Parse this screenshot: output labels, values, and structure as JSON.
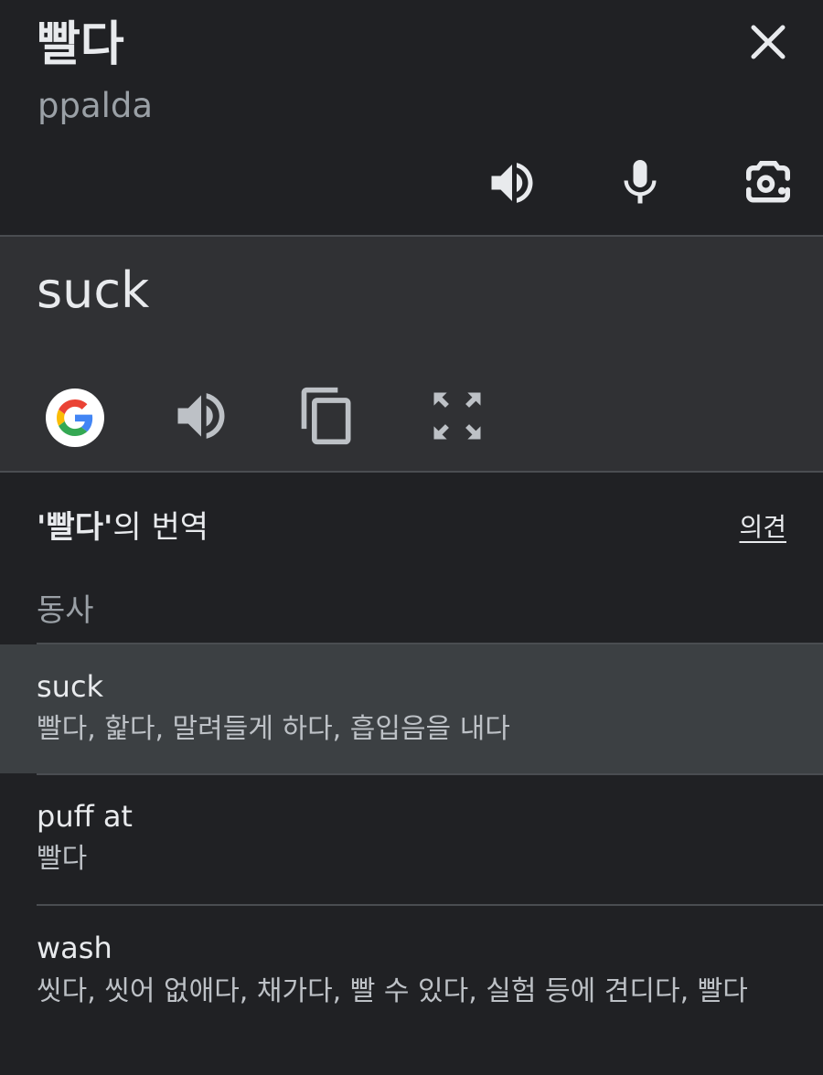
{
  "source": {
    "word": "빨다",
    "romanization": "ppalda"
  },
  "target": {
    "word": "suck"
  },
  "icons": {
    "close": "close-icon",
    "source_speaker": "speaker-icon",
    "mic": "microphone-icon",
    "camera": "camera-lens-icon",
    "google": "google-logo-icon",
    "target_speaker": "speaker-icon",
    "copy": "copy-icon",
    "fullscreen": "fullscreen-icon"
  },
  "translations": {
    "title_quote_open": "'",
    "title_word": "빨다",
    "title_quote_close": "'",
    "title_suffix": "의 번역",
    "feedback_label": "의견",
    "part_of_speech": "동사",
    "entries": [
      {
        "word": "suck",
        "synonyms": "빨다, 핥다, 말려들게 하다, 흡입음을 내다"
      },
      {
        "word": "puff at",
        "synonyms": "빨다"
      },
      {
        "word": "wash",
        "synonyms": "씻다, 씻어 없애다, 채가다, 빨 수 있다, 실험 등에 견디다, 빨다"
      }
    ]
  },
  "colors": {
    "background": "#202124",
    "target_panel": "#303134",
    "highlight_row": "#3c4043",
    "text": "#e8eaed",
    "muted_text": "#9aa0a6"
  }
}
